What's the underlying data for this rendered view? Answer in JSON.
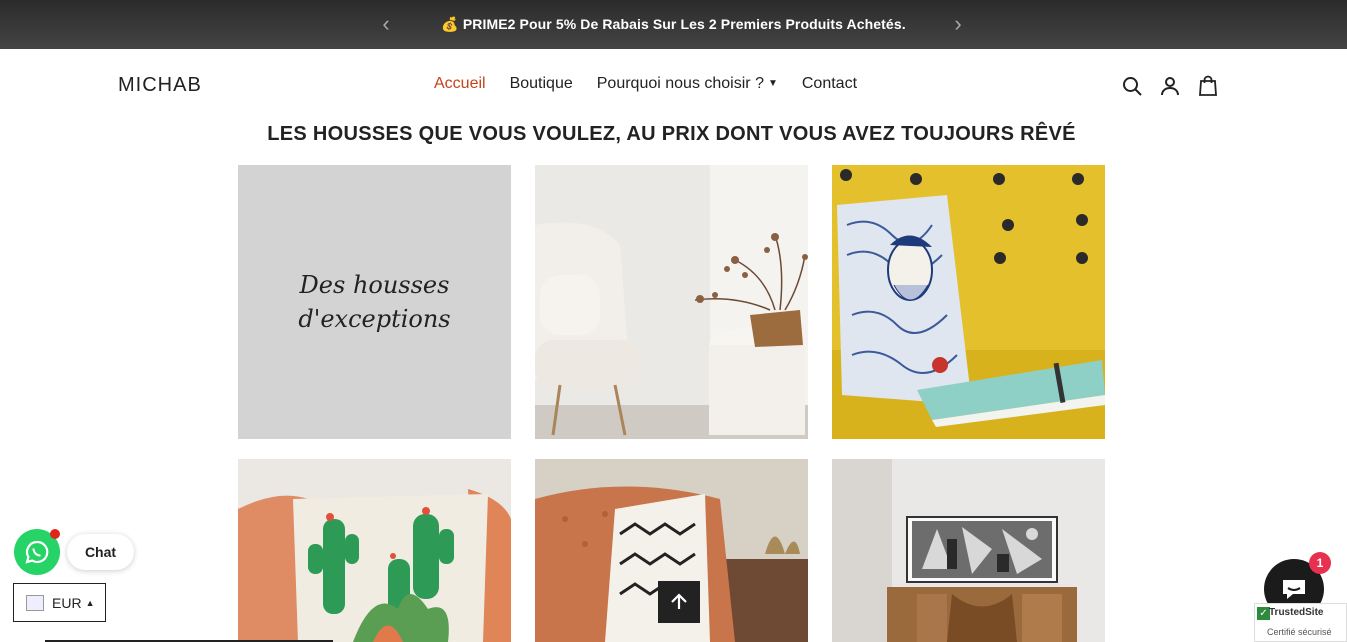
{
  "announcement": {
    "icon": "money-bag-icon",
    "emoji": "💰",
    "text": "PRIME2 Pour 5% De Rabais Sur Les 2 Premiers Produits Achetés."
  },
  "header": {
    "logo": "MICHAB",
    "nav": [
      {
        "label": "Accueil",
        "active": true
      },
      {
        "label": "Boutique"
      },
      {
        "label": "Pourquoi nous choisir ?"
      },
      {
        "label": "Contact"
      }
    ]
  },
  "section": {
    "title": "LES HOUSSES QUE VOUS VOULEZ, AU PRIX DONT VOUS AVEZ TOUJOURS RÊVÉ"
  },
  "tiles": {
    "first_caption_line1": "Des housses",
    "first_caption_line2": "d'exceptions"
  },
  "widgets": {
    "chat_label": "Chat",
    "currency": "EUR",
    "shop_chat_badge": "1",
    "trusted_title": "TrustedSite",
    "trusted_sub": "Certifié sécurisé"
  },
  "colors": {
    "accent": "#c4441c",
    "whatsapp": "#25d366",
    "badge": "#e8304f"
  }
}
